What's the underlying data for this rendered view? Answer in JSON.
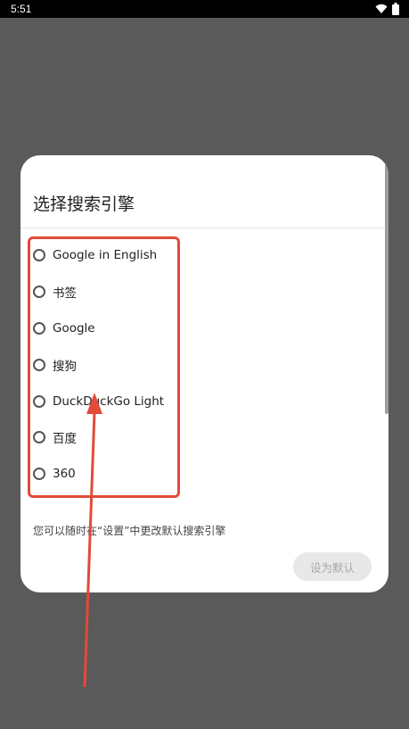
{
  "status_bar": {
    "time": "5:51"
  },
  "dialog": {
    "title": "选择搜索引擎",
    "options": [
      {
        "label": "Google in English",
        "selected": false
      },
      {
        "label": "书签",
        "selected": false
      },
      {
        "label": "Google",
        "selected": false
      },
      {
        "label": "搜狗",
        "selected": false
      },
      {
        "label": "DuckDuckGo Light",
        "selected": false
      },
      {
        "label": "百度",
        "selected": false
      },
      {
        "label": "360",
        "selected": false
      }
    ],
    "hint": "您可以随时在“设置”中更改默认搜索引擎",
    "set_default_label": "设为默认"
  },
  "colors": {
    "scrim": "#5a5a5a",
    "annotation": "#e24a3a",
    "button_disabled_bg": "#e8e8e8",
    "button_disabled_text": "#a8a8a8"
  }
}
